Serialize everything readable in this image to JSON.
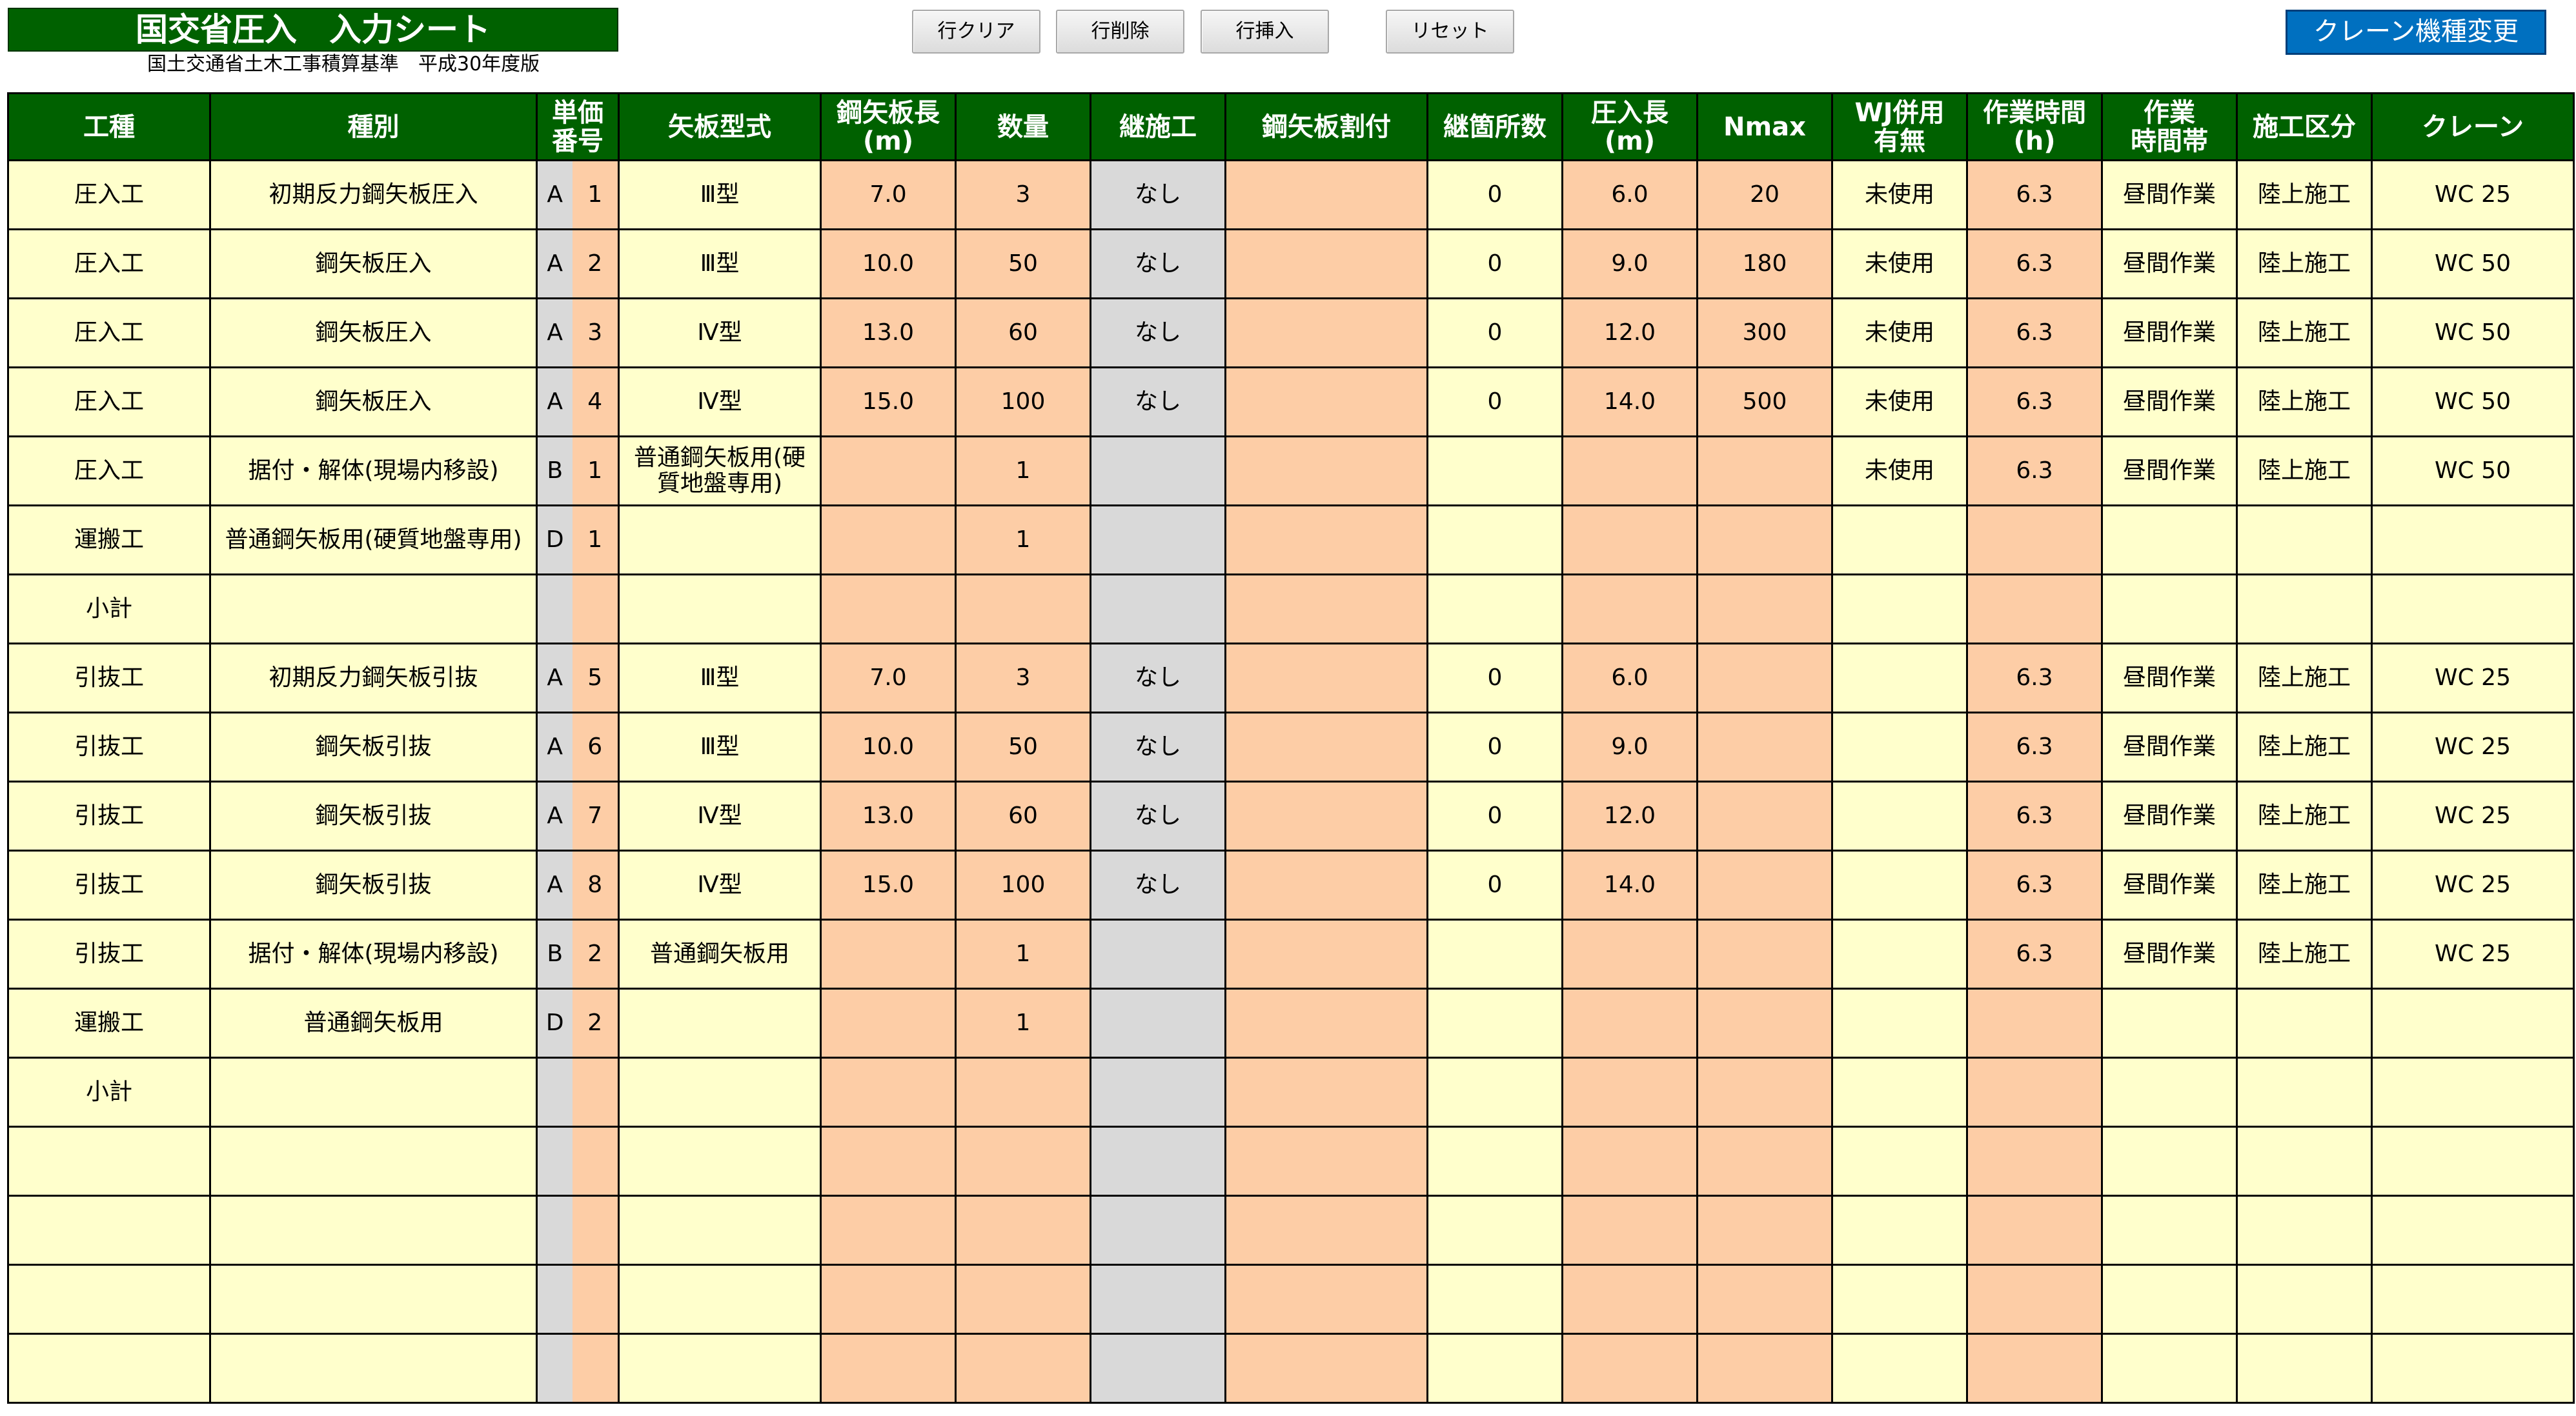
{
  "header": {
    "title": "国交省圧入　入力シート",
    "subtitle": "国土交通省土木工事積算基準　平成30年度版"
  },
  "toolbar": {
    "clear_label": "行クリア",
    "delete_label": "行削除",
    "insert_label": "行挿入",
    "reset_label": "リセット",
    "crane_change_label": "クレーン機種変更"
  },
  "colors": {
    "header_green": "#006100",
    "cell_yellow": "#ffffcc",
    "cell_peach": "#fdcda6",
    "cell_gray": "#d9d9d9",
    "button_blue": "#0070c0"
  },
  "table": {
    "columns": [
      {
        "line1": "工種",
        "line2": ""
      },
      {
        "line1": "種別",
        "line2": ""
      },
      {
        "line1": "単価",
        "line2": "番号"
      },
      {
        "line1": "矢板型式",
        "line2": ""
      },
      {
        "line1": "鋼矢板長",
        "line2": "(m)"
      },
      {
        "line1": "数量",
        "line2": ""
      },
      {
        "line1": "継施工",
        "line2": ""
      },
      {
        "line1": "鋼矢板割付",
        "line2": ""
      },
      {
        "line1": "継箇所数",
        "line2": ""
      },
      {
        "line1": "圧入長",
        "line2": "(m)"
      },
      {
        "line1": "Nmax",
        "line2": ""
      },
      {
        "line1": "WJ併用",
        "line2": "有無"
      },
      {
        "line1": "作業時間",
        "line2": "(h)"
      },
      {
        "line1": "作業",
        "line2": "時間帯"
      },
      {
        "line1": "施工区分",
        "line2": ""
      },
      {
        "line1": "クレーン",
        "line2": ""
      }
    ],
    "rows": [
      {
        "koushu": "圧入工",
        "shubetsu": "初期反力鋼矢板圧入",
        "code_letter": "A",
        "code_num": "1",
        "kata": "Ⅲ型",
        "length": "7.0",
        "qty": "3",
        "tsugi": "なし",
        "waritsuke": "",
        "kasho": "0",
        "atsunyu": "6.0",
        "nmax": "20",
        "wj": "未使用",
        "hours": "6.3",
        "jikantai": "昼間作業",
        "kubun": "陸上施工",
        "crane": "WC 25"
      },
      {
        "koushu": "圧入工",
        "shubetsu": "鋼矢板圧入",
        "code_letter": "A",
        "code_num": "2",
        "kata": "Ⅲ型",
        "length": "10.0",
        "qty": "50",
        "tsugi": "なし",
        "waritsuke": "",
        "kasho": "0",
        "atsunyu": "9.0",
        "nmax": "180",
        "wj": "未使用",
        "hours": "6.3",
        "jikantai": "昼間作業",
        "kubun": "陸上施工",
        "crane": "WC 50"
      },
      {
        "koushu": "圧入工",
        "shubetsu": "鋼矢板圧入",
        "code_letter": "A",
        "code_num": "3",
        "kata": "Ⅳ型",
        "length": "13.0",
        "qty": "60",
        "tsugi": "なし",
        "waritsuke": "",
        "kasho": "0",
        "atsunyu": "12.0",
        "nmax": "300",
        "wj": "未使用",
        "hours": "6.3",
        "jikantai": "昼間作業",
        "kubun": "陸上施工",
        "crane": "WC 50"
      },
      {
        "koushu": "圧入工",
        "shubetsu": "鋼矢板圧入",
        "code_letter": "A",
        "code_num": "4",
        "kata": "Ⅳ型",
        "length": "15.0",
        "qty": "100",
        "tsugi": "なし",
        "waritsuke": "",
        "kasho": "0",
        "atsunyu": "14.0",
        "nmax": "500",
        "wj": "未使用",
        "hours": "6.3",
        "jikantai": "昼間作業",
        "kubun": "陸上施工",
        "crane": "WC 50"
      },
      {
        "koushu": "圧入工",
        "shubetsu": "据付・解体(現場内移設)",
        "code_letter": "B",
        "code_num": "1",
        "kata": "普通鋼矢板用(硬質地盤専用)",
        "length": "",
        "qty": "1",
        "tsugi": "",
        "waritsuke": "",
        "kasho": "",
        "atsunyu": "",
        "nmax": "",
        "wj": "未使用",
        "hours": "6.3",
        "jikantai": "昼間作業",
        "kubun": "陸上施工",
        "crane": "WC 50"
      },
      {
        "koushu": "運搬工",
        "shubetsu": "普通鋼矢板用(硬質地盤専用)",
        "code_letter": "D",
        "code_num": "1",
        "kata": "",
        "length": "",
        "qty": "1",
        "tsugi": "",
        "waritsuke": "",
        "kasho": "",
        "atsunyu": "",
        "nmax": "",
        "wj": "",
        "hours": "",
        "jikantai": "",
        "kubun": "",
        "crane": ""
      },
      {
        "koushu": "小計",
        "shubetsu": "",
        "code_letter": "",
        "code_num": "",
        "kata": "",
        "length": "",
        "qty": "",
        "tsugi": "",
        "waritsuke": "",
        "kasho": "",
        "atsunyu": "",
        "nmax": "",
        "wj": "",
        "hours": "",
        "jikantai": "",
        "kubun": "",
        "crane": ""
      },
      {
        "koushu": "引抜工",
        "shubetsu": "初期反力鋼矢板引抜",
        "code_letter": "A",
        "code_num": "5",
        "kata": "Ⅲ型",
        "length": "7.0",
        "qty": "3",
        "tsugi": "なし",
        "waritsuke": "",
        "kasho": "0",
        "atsunyu": "6.0",
        "nmax": "",
        "wj": "",
        "hours": "6.3",
        "jikantai": "昼間作業",
        "kubun": "陸上施工",
        "crane": "WC 25"
      },
      {
        "koushu": "引抜工",
        "shubetsu": "鋼矢板引抜",
        "code_letter": "A",
        "code_num": "6",
        "kata": "Ⅲ型",
        "length": "10.0",
        "qty": "50",
        "tsugi": "なし",
        "waritsuke": "",
        "kasho": "0",
        "atsunyu": "9.0",
        "nmax": "",
        "wj": "",
        "hours": "6.3",
        "jikantai": "昼間作業",
        "kubun": "陸上施工",
        "crane": "WC 25"
      },
      {
        "koushu": "引抜工",
        "shubetsu": "鋼矢板引抜",
        "code_letter": "A",
        "code_num": "7",
        "kata": "Ⅳ型",
        "length": "13.0",
        "qty": "60",
        "tsugi": "なし",
        "waritsuke": "",
        "kasho": "0",
        "atsunyu": "12.0",
        "nmax": "",
        "wj": "",
        "hours": "6.3",
        "jikantai": "昼間作業",
        "kubun": "陸上施工",
        "crane": "WC 25"
      },
      {
        "koushu": "引抜工",
        "shubetsu": "鋼矢板引抜",
        "code_letter": "A",
        "code_num": "8",
        "kata": "Ⅳ型",
        "length": "15.0",
        "qty": "100",
        "tsugi": "なし",
        "waritsuke": "",
        "kasho": "0",
        "atsunyu": "14.0",
        "nmax": "",
        "wj": "",
        "hours": "6.3",
        "jikantai": "昼間作業",
        "kubun": "陸上施工",
        "crane": "WC 25"
      },
      {
        "koushu": "引抜工",
        "shubetsu": "据付・解体(現場内移設)",
        "code_letter": "B",
        "code_num": "2",
        "kata": "普通鋼矢板用",
        "length": "",
        "qty": "1",
        "tsugi": "",
        "waritsuke": "",
        "kasho": "",
        "atsunyu": "",
        "nmax": "",
        "wj": "",
        "hours": "6.3",
        "jikantai": "昼間作業",
        "kubun": "陸上施工",
        "crane": "WC 25"
      },
      {
        "koushu": "運搬工",
        "shubetsu": "普通鋼矢板用",
        "code_letter": "D",
        "code_num": "2",
        "kata": "",
        "length": "",
        "qty": "1",
        "tsugi": "",
        "waritsuke": "",
        "kasho": "",
        "atsunyu": "",
        "nmax": "",
        "wj": "",
        "hours": "",
        "jikantai": "",
        "kubun": "",
        "crane": ""
      },
      {
        "koushu": "小計",
        "shubetsu": "",
        "code_letter": "",
        "code_num": "",
        "kata": "",
        "length": "",
        "qty": "",
        "tsugi": "",
        "waritsuke": "",
        "kasho": "",
        "atsunyu": "",
        "nmax": "",
        "wj": "",
        "hours": "",
        "jikantai": "",
        "kubun": "",
        "crane": ""
      },
      {
        "koushu": "",
        "shubetsu": "",
        "code_letter": "",
        "code_num": "",
        "kata": "",
        "length": "",
        "qty": "",
        "tsugi": "",
        "waritsuke": "",
        "kasho": "",
        "atsunyu": "",
        "nmax": "",
        "wj": "",
        "hours": "",
        "jikantai": "",
        "kubun": "",
        "crane": ""
      },
      {
        "koushu": "",
        "shubetsu": "",
        "code_letter": "",
        "code_num": "",
        "kata": "",
        "length": "",
        "qty": "",
        "tsugi": "",
        "waritsuke": "",
        "kasho": "",
        "atsunyu": "",
        "nmax": "",
        "wj": "",
        "hours": "",
        "jikantai": "",
        "kubun": "",
        "crane": ""
      },
      {
        "koushu": "",
        "shubetsu": "",
        "code_letter": "",
        "code_num": "",
        "kata": "",
        "length": "",
        "qty": "",
        "tsugi": "",
        "waritsuke": "",
        "kasho": "",
        "atsunyu": "",
        "nmax": "",
        "wj": "",
        "hours": "",
        "jikantai": "",
        "kubun": "",
        "crane": ""
      },
      {
        "koushu": "",
        "shubetsu": "",
        "code_letter": "",
        "code_num": "",
        "kata": "",
        "length": "",
        "qty": "",
        "tsugi": "",
        "waritsuke": "",
        "kasho": "",
        "atsunyu": "",
        "nmax": "",
        "wj": "",
        "hours": "",
        "jikantai": "",
        "kubun": "",
        "crane": ""
      }
    ]
  }
}
